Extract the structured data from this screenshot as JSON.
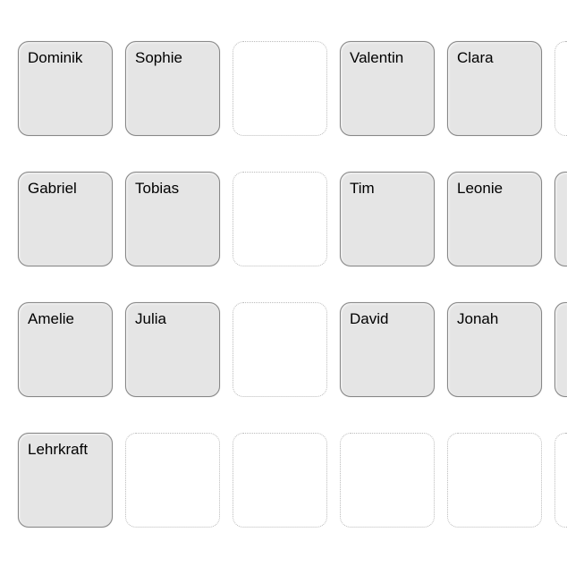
{
  "seating": {
    "rows": [
      {
        "seats": [
          {
            "label": "Dominik",
            "filled": true
          },
          {
            "label": "Sophie",
            "filled": true
          },
          {
            "label": "",
            "filled": false
          },
          {
            "label": "Valentin",
            "filled": true
          },
          {
            "label": "Clara",
            "filled": true
          },
          {
            "label": "",
            "filled": false,
            "partial": true
          }
        ]
      },
      {
        "seats": [
          {
            "label": "Gabriel",
            "filled": true
          },
          {
            "label": "Tobias",
            "filled": true
          },
          {
            "label": "",
            "filled": false
          },
          {
            "label": "Tim",
            "filled": true
          },
          {
            "label": "Leonie",
            "filled": true
          },
          {
            "label": "",
            "filled": true,
            "partial": true
          }
        ]
      },
      {
        "seats": [
          {
            "label": "Amelie",
            "filled": true
          },
          {
            "label": "Julia",
            "filled": true
          },
          {
            "label": "",
            "filled": false
          },
          {
            "label": "David",
            "filled": true
          },
          {
            "label": "Jonah",
            "filled": true
          },
          {
            "label": "",
            "filled": true,
            "partial": true
          }
        ]
      },
      {
        "seats": [
          {
            "label": "Lehrkraft",
            "filled": true
          },
          {
            "label": "",
            "filled": false
          },
          {
            "label": "",
            "filled": false
          },
          {
            "label": "",
            "filled": false
          },
          {
            "label": "",
            "filled": false
          },
          {
            "label": "",
            "filled": false,
            "partial": true
          }
        ]
      }
    ]
  }
}
